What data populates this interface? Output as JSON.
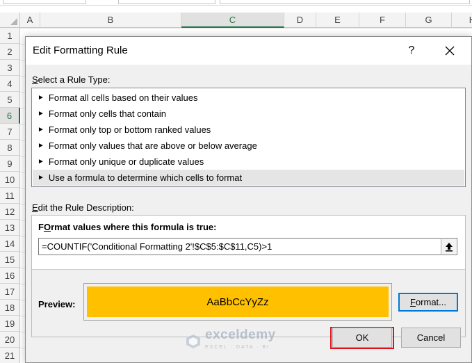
{
  "spreadsheet": {
    "columns": [
      "A",
      "B",
      "C",
      "D",
      "E",
      "F",
      "G",
      "H"
    ],
    "selected_column": "C",
    "rows": [
      "1",
      "2",
      "3",
      "4",
      "5",
      "6",
      "7",
      "8",
      "9",
      "10",
      "11",
      "12",
      "13",
      "14",
      "15",
      "16",
      "17",
      "18",
      "19",
      "20",
      "21"
    ],
    "selected_row": "6"
  },
  "dialog": {
    "title": "Edit Formatting Rule",
    "help_label": "?",
    "close_icon": "close-icon",
    "rule_type_label_u": "S",
    "rule_type_label_rest": "elect a Rule Type:",
    "rule_types": [
      "Format all cells based on their values",
      "Format only cells that contain",
      "Format only top or bottom ranked values",
      "Format only values that are above or below average",
      "Format only unique or duplicate values",
      "Use a formula to determine which cells to format"
    ],
    "selected_rule_index": 5,
    "edit_desc_label_u": "E",
    "edit_desc_label_rest": "dit the Rule Description:",
    "formula_heading_u": "O",
    "formula_heading_pre": "F",
    "formula_heading_rest": "rmat values where this formula is true:",
    "formula_value": "=COUNTIF('Conditional Formatting 2'!$C$5:$C$11,C5)>1",
    "preview_label": "Preview:",
    "preview_text": "AaBbCcYyZz",
    "preview_color": "#ffc000",
    "format_button_pre": "",
    "format_button_u": "F",
    "format_button_rest": "ormat...",
    "ok_label": "OK",
    "cancel_label": "Cancel"
  },
  "watermark": {
    "name": "exceldemy",
    "tagline": "EXCEL · DATA · BI"
  }
}
